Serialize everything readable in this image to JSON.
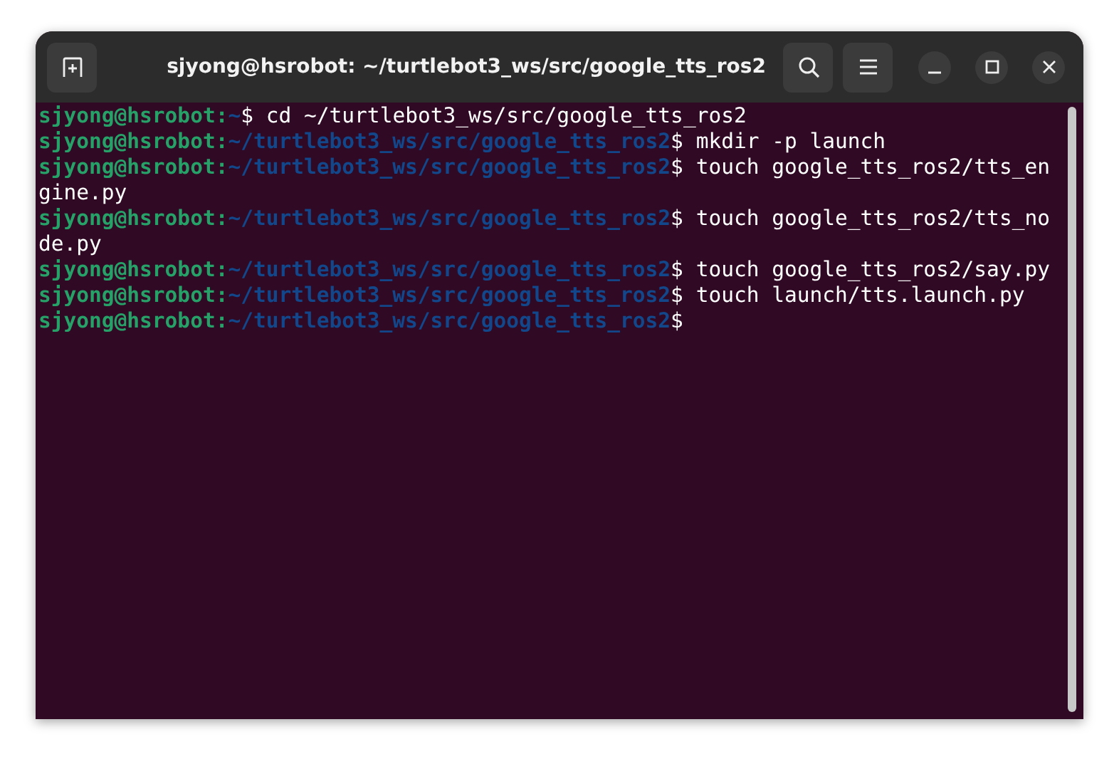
{
  "window": {
    "title": "sjyong@hsrobot: ~/turtlebot3_ws/src/google_tts_ros2"
  },
  "terminal": {
    "lines": [
      {
        "kind": "prompt",
        "user": "sjyong@hsrobot:",
        "path": "~",
        "symbol": "$",
        "command": "cd ~/turtlebot3_ws/src/google_tts_ros2"
      },
      {
        "kind": "prompt",
        "user": "sjyong@hsrobot:",
        "path": "~/turtlebot3_ws/src/google_tts_ros2",
        "symbol": "$",
        "command": "mkdir -p launch"
      },
      {
        "kind": "prompt",
        "user": "sjyong@hsrobot:",
        "path": "~/turtlebot3_ws/src/google_tts_ros2",
        "symbol": "$",
        "command": "touch google_tts_ros2/tts_en"
      },
      {
        "kind": "wrap",
        "text": "gine.py"
      },
      {
        "kind": "prompt",
        "user": "sjyong@hsrobot:",
        "path": "~/turtlebot3_ws/src/google_tts_ros2",
        "symbol": "$",
        "command": "touch google_tts_ros2/tts_no"
      },
      {
        "kind": "wrap",
        "text": "de.py"
      },
      {
        "kind": "prompt",
        "user": "sjyong@hsrobot:",
        "path": "~/turtlebot3_ws/src/google_tts_ros2",
        "symbol": "$",
        "command": "touch google_tts_ros2/say.py"
      },
      {
        "kind": "prompt",
        "user": "sjyong@hsrobot:",
        "path": "~/turtlebot3_ws/src/google_tts_ros2",
        "symbol": "$",
        "command": "touch launch/tts.launch.py"
      },
      {
        "kind": "prompt",
        "user": "sjyong@hsrobot:",
        "path": "~/turtlebot3_ws/src/google_tts_ros2",
        "symbol": "$"
      }
    ]
  }
}
